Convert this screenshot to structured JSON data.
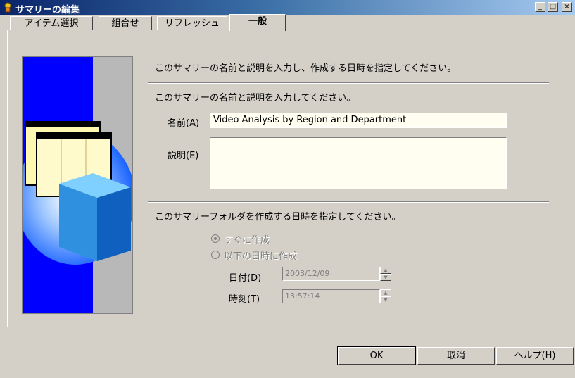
{
  "window": {
    "title": "サマリーの編集",
    "minimize": "_",
    "maximize": "□",
    "close": "×"
  },
  "tabs": [
    {
      "label": "アイテム選択"
    },
    {
      "label": "組合せ"
    },
    {
      "label": "リフレッシュ"
    },
    {
      "label": "一般"
    }
  ],
  "active_tab": "一般",
  "intro_text": "このサマリーの名前と説明を入力し、作成する日時を指定してください。",
  "name_section": {
    "heading": "このサマリーの名前と説明を入力してください。",
    "name_label": "名前(A)",
    "name_value": "Video Analysis by Region and Department",
    "description_label": "説明(E)",
    "description_value": ""
  },
  "schedule_section": {
    "heading": "このサマリーフォルダを作成する日時を指定してください。",
    "radio_now": "すぐに作成",
    "radio_later": "以下の日時に作成",
    "selected": "すぐに作成",
    "date_label": "日付(D)",
    "date_value": "2003/12/09",
    "time_label": "時刻(T)",
    "time_value": "13:57:14"
  },
  "buttons": {
    "ok": "OK",
    "cancel": "取消",
    "help": "ヘルプ(H)"
  },
  "colors": {
    "titlebar_start": "#0a246a",
    "titlebar_end": "#a6caf0",
    "dialog_bg": "#d4d0c8",
    "side_blue": "#0000ff"
  }
}
